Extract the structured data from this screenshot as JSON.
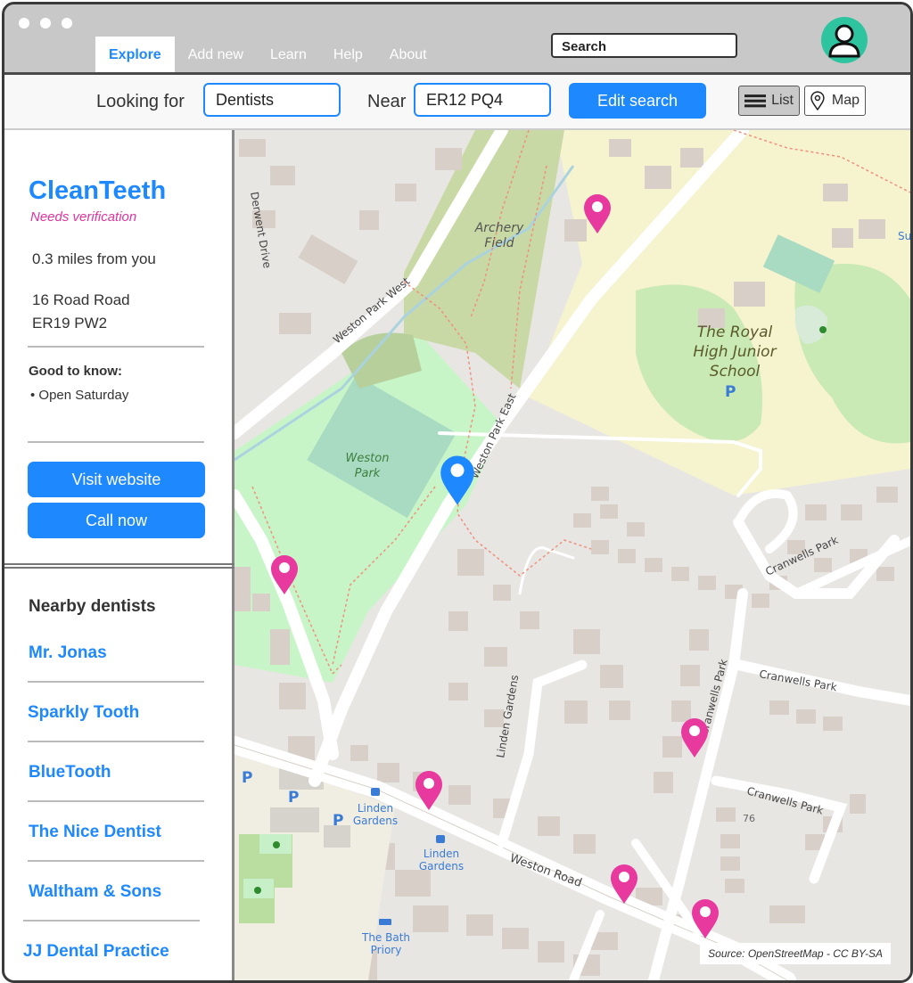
{
  "nav": {
    "tabs": [
      "Explore",
      "Add new",
      "Learn",
      "Help",
      "About"
    ],
    "search_label": "Search"
  },
  "search": {
    "looking_for_label": "Looking for",
    "looking_for_value": "Dentists",
    "near_label": "Near",
    "near_value": "ER12 PQ4",
    "edit_button": "Edit search",
    "list_toggle": "List",
    "map_toggle": "Map"
  },
  "listing": {
    "name": "CleanTeeth",
    "status": "Needs verification",
    "distance": "0.3 miles from you",
    "address_line1": "16 Road Road",
    "address_line2": "ER19 PW2",
    "good_to_know_label": "Good to know:",
    "good_to_know_items": [
      "Open Saturday"
    ],
    "visit_button": "Visit website",
    "call_button": "Call now"
  },
  "nearby": {
    "heading": "Nearby dentists",
    "items": [
      "Mr. Jonas",
      "Sparkly Tooth",
      "BlueTooth",
      "The Nice Dentist",
      "Waltham & Sons",
      "JJ Dental Practice"
    ]
  },
  "map": {
    "labels": {
      "archery": [
        "Archery",
        "Field"
      ],
      "school": [
        "The Royal",
        "High Junior",
        "School"
      ],
      "park": [
        "Weston",
        "Park"
      ],
      "weston_park_west": "Weston Park West",
      "weston_park_east": "Weston Park East",
      "derwent": "Derwent Drive",
      "cranwells_1": "Cranwells Park",
      "cranwells_2": "Cranwells Park",
      "cranwells_3": "Cranwells Park",
      "cranwells_4": "Cranwells Park",
      "linden_gardens_road": "Linden Gardens",
      "linden_gardens_stop1": [
        "Linden",
        "Gardens"
      ],
      "linden_gardens_stop2": [
        "Linden",
        "Gardens"
      ],
      "weston_road": "Weston Road",
      "bath_priory": [
        "The Bath",
        "Priory"
      ],
      "house_number": "76",
      "parking": "P",
      "edge_label": "Sur"
    },
    "source": "Source: OpenStreetMap - CC BY-SA"
  },
  "colors": {
    "accent": "#1e88ff",
    "status_pink": "#e0339d",
    "pin_pink": "#e8399e",
    "pin_blue": "#1e88ff",
    "avatar": "#2ec4a0"
  }
}
